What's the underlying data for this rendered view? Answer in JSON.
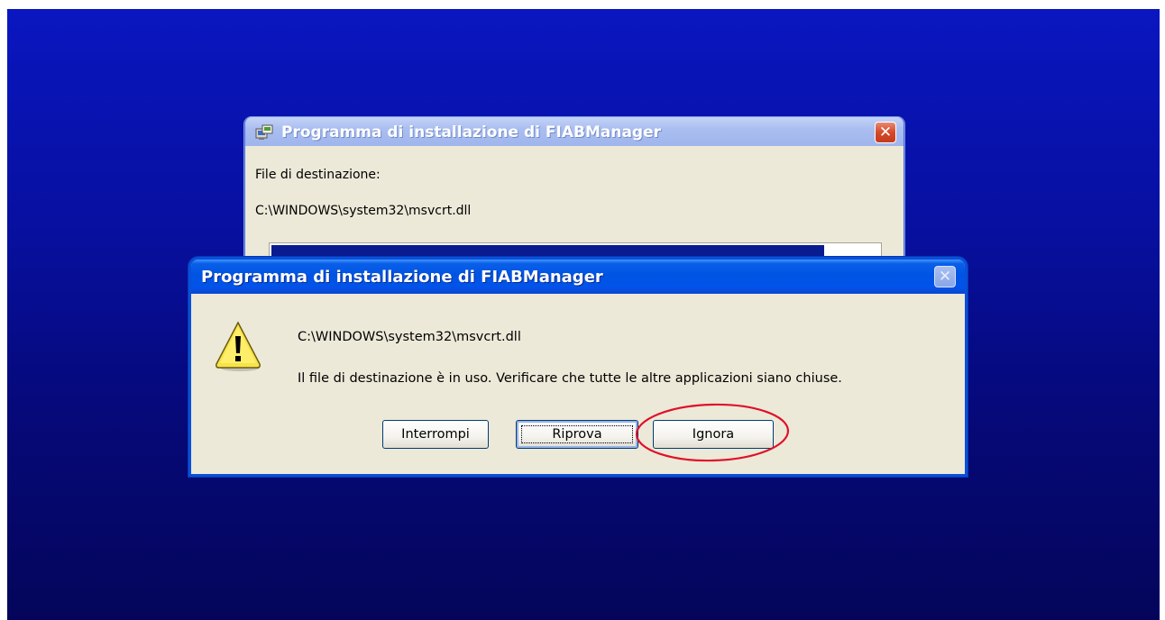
{
  "back_window": {
    "title": "Programma di installazione di FIABManager",
    "destination_label": "File di destinazione:",
    "destination_path": "C:\\WINDOWS\\system32\\msvcrt.dll",
    "progress_fraction": 0.91,
    "icon": "installer-icon",
    "close_icon": "close-icon"
  },
  "dialog": {
    "title": "Programma di installazione di FIABManager",
    "icon": "warning-icon",
    "file_path": "C:\\WINDOWS\\system32\\msvcrt.dll",
    "message": "Il file di destinazione è in uso. Verificare che tutte le altre applicazioni siano chiuse.",
    "buttons": {
      "abort": "Interrompi",
      "retry": "Riprova",
      "ignore": "Ignora"
    },
    "focused_button": "retry",
    "annotated_button": "ignore",
    "annotation_color": "#e0102a"
  }
}
